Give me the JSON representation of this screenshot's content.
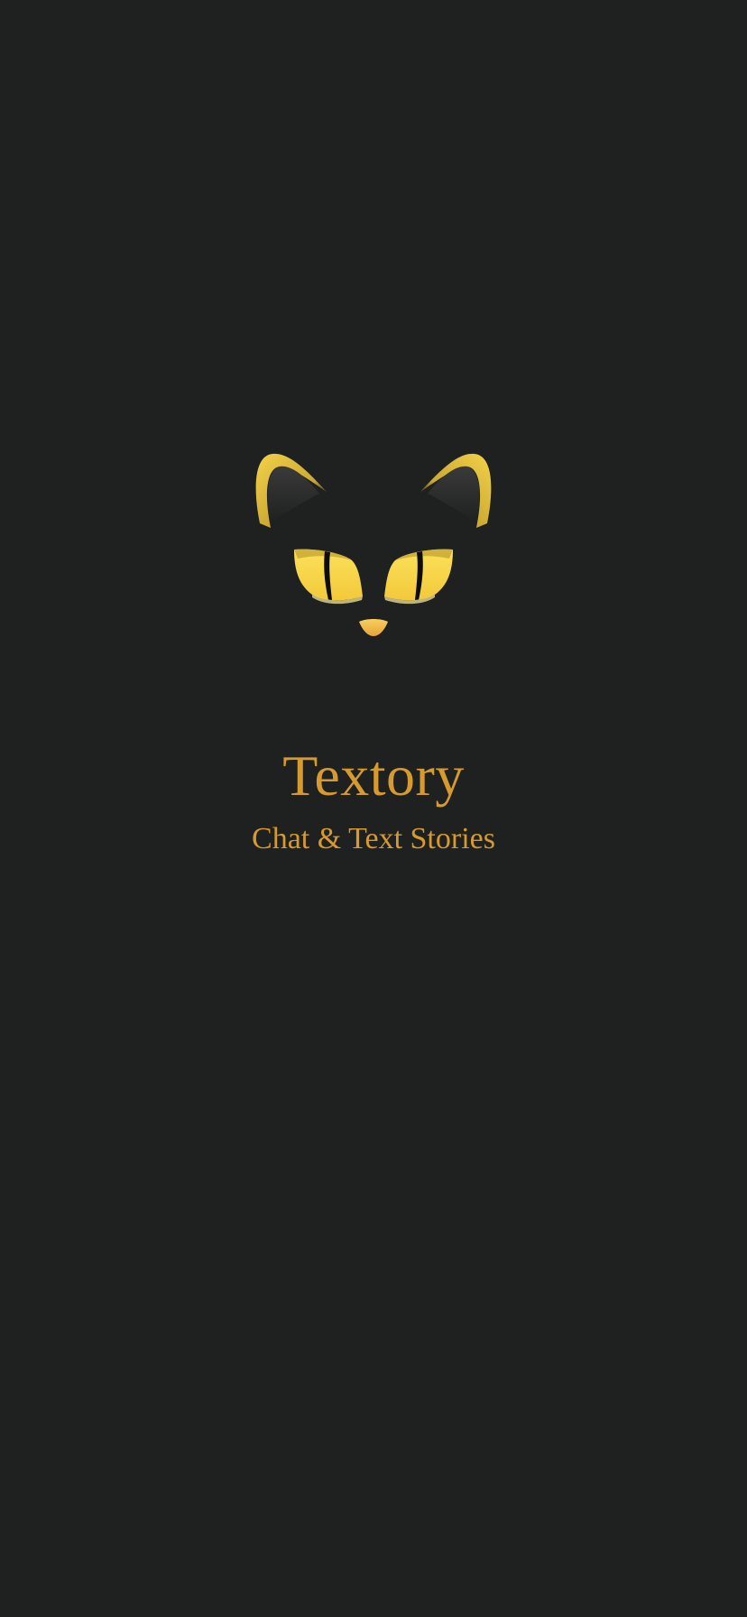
{
  "app": {
    "title": "Textory",
    "subtitle": "Chat & Text Stories"
  },
  "logo": {
    "icon": "cat-face-icon"
  },
  "colors": {
    "background": "#1f2020",
    "text_accent": "#d69a2e",
    "eye_yellow": "#f7d64a",
    "ear_gold": "#e8c23c",
    "nose": "#f3b94e"
  }
}
